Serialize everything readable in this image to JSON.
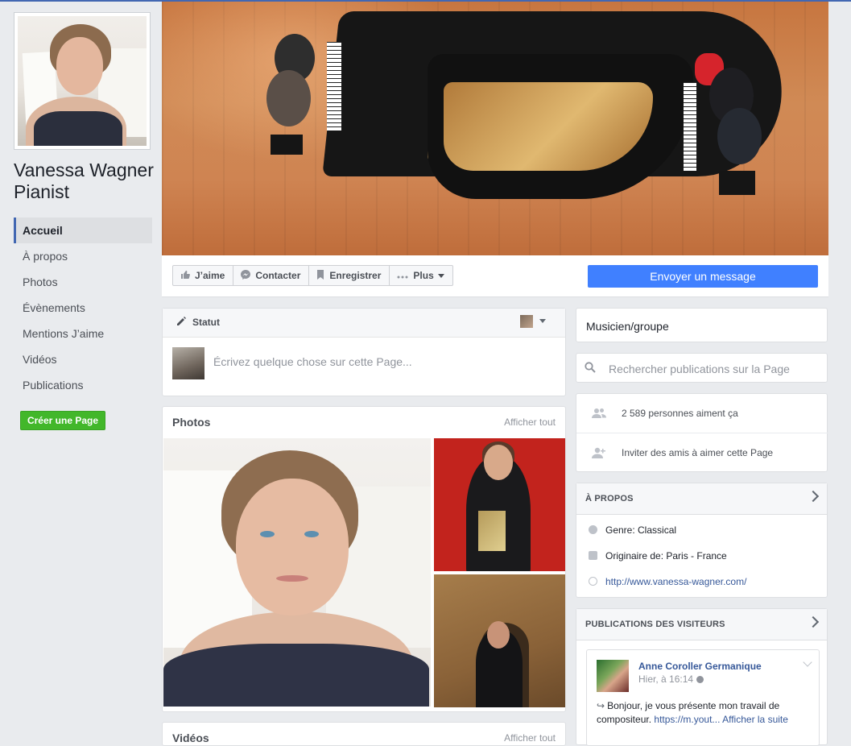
{
  "page": {
    "name": "Vanessa Wagner Pianist"
  },
  "nav": {
    "items": [
      {
        "label": "Accueil"
      },
      {
        "label": "À propos"
      },
      {
        "label": "Photos"
      },
      {
        "label": "Évènements"
      },
      {
        "label": "Mentions J’aime"
      },
      {
        "label": "Vidéos"
      },
      {
        "label": "Publications"
      }
    ],
    "create_page": "Créer une Page"
  },
  "actions": {
    "like": "J’aime",
    "contact": "Contacter",
    "save": "Enregistrer",
    "more": "Plus",
    "send_message": "Envoyer un message"
  },
  "composer": {
    "tab_label": "Statut",
    "placeholder": "Écrivez quelque chose sur cette Page..."
  },
  "photos": {
    "title": "Photos",
    "see_all": "Afficher tout"
  },
  "videos": {
    "title": "Vidéos",
    "see_all": "Afficher tout"
  },
  "sidebar": {
    "category": "Musicien/groupe",
    "search_placeholder": "Rechercher publications sur la Page",
    "likes_count": "2 589 personnes aiment ça",
    "invite": "Inviter des amis à aimer cette Page"
  },
  "about": {
    "title": "À PROPOS",
    "genre": "Genre: Classical",
    "origin": "Originaire de: Paris - France",
    "website": "http://www.vanessa-wagner.com/"
  },
  "visitors": {
    "title": "PUBLICATIONS DES VISITEURS",
    "post": {
      "author": "Anne Coroller Germanique",
      "time": "Hier, à 16:14",
      "text_line1": "Bonjour, je vous présente mon travail de",
      "text_line2_plain": "compositeur.",
      "link": "https://m.yout...",
      "see_more": "Afficher la suite"
    }
  },
  "colors": {
    "brand_blue": "#4267b2",
    "send_button": "#4080ff",
    "create_page_green": "#42b72a",
    "link": "#365899",
    "background": "#e9ebee"
  }
}
